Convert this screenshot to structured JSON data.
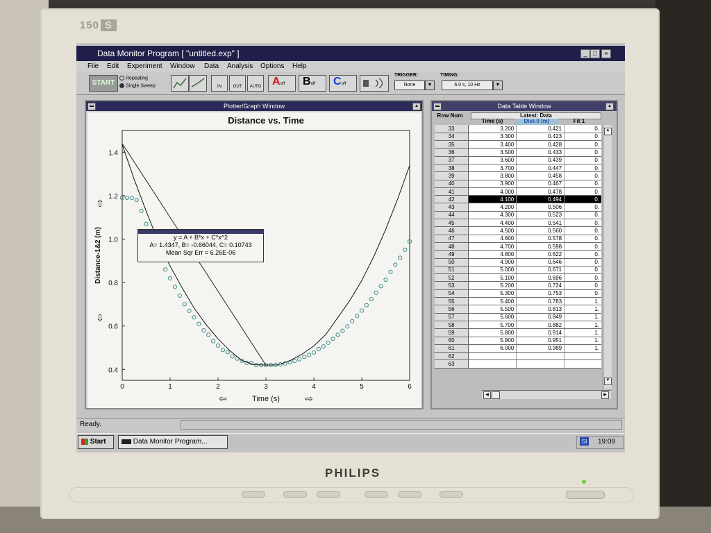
{
  "monitor": {
    "model": "150",
    "model_suffix": "S",
    "brand": "PHILIPS"
  },
  "app": {
    "title": "Data Monitor Program [ \"untitled.exp\" ]",
    "menu": [
      "File",
      "Edit",
      "Experiment",
      "Window",
      "Data",
      "Analysis",
      "Options",
      "Help"
    ],
    "toolbar": {
      "start_label": "START",
      "repeating_label": "Repeating",
      "single_sweep_label": "Single Sweep",
      "mode_selected": "Single Sweep",
      "zoom_in": "IN",
      "zoom_out": "OUT",
      "auto": "AUTO",
      "channel_a": "A",
      "channel_b": "B",
      "channel_c": "C",
      "channel_suffix": "off",
      "trigger_label": "TRIGGER:",
      "trigger_value": "None",
      "timing_label": "TIMING:",
      "timing_value": "6.0 s, 10 Hz"
    }
  },
  "plotter": {
    "window_title": "Plotter/Graph Window",
    "fit_box": {
      "equation": "y = A + B*x + C*x^2",
      "coefficients": "A= 1.4347,  B= -0.66044,  C= 0.10743",
      "error": "Mean Sqr Err = 6.26E-06"
    }
  },
  "chart_data": {
    "type": "scatter",
    "title": "Distance vs. Time",
    "xlabel": "Time (s)",
    "ylabel": "Distance-1&2 (m)",
    "xlim": [
      0,
      6
    ],
    "ylim": [
      0.35,
      1.5
    ],
    "xticks": [
      "0",
      "1",
      "2",
      "3",
      "4",
      "5",
      "6"
    ],
    "yticks": [
      "0.4",
      "0.6",
      "0.8",
      "1.0",
      "1.2",
      "1.4"
    ],
    "series": [
      {
        "name": "",
        "kind": "points",
        "color": "#3d8a8a",
        "x": [
          0.0,
          0.1,
          0.2,
          0.3,
          0.4,
          0.5,
          0.6,
          0.7,
          0.8,
          0.9,
          1.0,
          1.1,
          1.2,
          1.3,
          1.4,
          1.5,
          1.6,
          1.7,
          1.8,
          1.9,
          2.0,
          2.1,
          2.2,
          2.3,
          2.4,
          2.5,
          2.6,
          2.7,
          2.8,
          2.9,
          3.0,
          3.1,
          3.2,
          3.3,
          3.4,
          3.5,
          3.6,
          3.7,
          3.8,
          3.9,
          4.0,
          4.1,
          4.2,
          4.3,
          4.4,
          4.5,
          4.6,
          4.7,
          4.8,
          4.9,
          5.0,
          5.1,
          5.2,
          5.3,
          5.4,
          5.5,
          5.6,
          5.7,
          5.8,
          5.9,
          6.0
        ],
        "y": [
          1.19,
          1.19,
          1.19,
          1.18,
          1.13,
          1.07,
          1.01,
          0.96,
          0.91,
          0.86,
          0.82,
          0.78,
          0.74,
          0.7,
          0.67,
          0.64,
          0.61,
          0.58,
          0.56,
          0.53,
          0.51,
          0.49,
          0.48,
          0.46,
          0.45,
          0.44,
          0.43,
          0.43,
          0.42,
          0.42,
          0.42,
          0.42,
          0.421,
          0.423,
          0.428,
          0.433,
          0.439,
          0.447,
          0.458,
          0.467,
          0.478,
          0.494,
          0.506,
          0.523,
          0.541,
          0.56,
          0.578,
          0.598,
          0.622,
          0.646,
          0.671,
          0.696,
          0.724,
          0.753,
          0.783,
          0.813,
          0.849,
          0.882,
          0.914,
          0.951,
          0.989
        ]
      },
      {
        "name": "",
        "kind": "fit",
        "color": "#111111",
        "x": [
          0.0,
          0.25,
          0.5,
          0.75,
          1.0,
          1.25,
          1.5,
          1.75,
          2.0,
          2.25,
          2.5,
          2.75,
          3.0,
          3.25,
          3.5,
          3.75,
          4.0,
          4.25,
          4.5,
          4.75,
          5.0,
          5.25,
          5.5,
          5.75,
          6.0
        ],
        "y": [
          1.435,
          1.275,
          1.129,
          0.99,
          0.876,
          0.776,
          0.683,
          0.607,
          0.541,
          0.486,
          0.441,
          0.422,
          0.42,
          0.421,
          0.44,
          0.47,
          0.508,
          0.561,
          0.639,
          0.717,
          0.809,
          0.919,
          1.045,
          1.185,
          1.339
        ]
      },
      {
        "name": "",
        "kind": "line",
        "color": "#222222",
        "x": [
          0.0,
          3.0
        ],
        "y": [
          1.44,
          0.42
        ]
      }
    ]
  },
  "table": {
    "window_title": "Data Table Window",
    "row_num_label": "Row Num",
    "latest_label": "Latest: Data",
    "columns": [
      "Time (s)",
      "Dist-0 (m)",
      "Fit 1"
    ],
    "selected_row": "42",
    "rows": [
      [
        "33",
        "3.200",
        "0.421",
        "0."
      ],
      [
        "34",
        "3.300",
        "0.423",
        "0."
      ],
      [
        "35",
        "3.400",
        "0.428",
        "0."
      ],
      [
        "36",
        "3.500",
        "0.433",
        "0."
      ],
      [
        "37",
        "3.600",
        "0.439",
        "0."
      ],
      [
        "38",
        "3.700",
        "0.447",
        "0."
      ],
      [
        "39",
        "3.800",
        "0.458",
        "0."
      ],
      [
        "40",
        "3.900",
        "0.467",
        "0."
      ],
      [
        "41",
        "4.000",
        "0.478",
        "0."
      ],
      [
        "42",
        "4.100",
        "0.494",
        "0."
      ],
      [
        "43",
        "4.200",
        "0.506",
        "0."
      ],
      [
        "44",
        "4.300",
        "0.523",
        "0."
      ],
      [
        "45",
        "4.400",
        "0.541",
        "0."
      ],
      [
        "46",
        "4.500",
        "0.560",
        "0."
      ],
      [
        "47",
        "4.600",
        "0.578",
        "0."
      ],
      [
        "48",
        "4.700",
        "0.598",
        "0."
      ],
      [
        "49",
        "4.800",
        "0.622",
        "0."
      ],
      [
        "50",
        "4.900",
        "0.646",
        "0."
      ],
      [
        "51",
        "5.000",
        "0.671",
        "0."
      ],
      [
        "52",
        "5.100",
        "0.696",
        "0."
      ],
      [
        "53",
        "5.200",
        "0.724",
        "0."
      ],
      [
        "54",
        "5.300",
        "0.753",
        "0."
      ],
      [
        "55",
        "5.400",
        "0.783",
        "1."
      ],
      [
        "56",
        "5.500",
        "0.813",
        "1."
      ],
      [
        "57",
        "5.600",
        "0.849",
        "1."
      ],
      [
        "58",
        "5.700",
        "0.882",
        "1."
      ],
      [
        "59",
        "5.800",
        "0.914",
        "1."
      ],
      [
        "60",
        "5.900",
        "0.951",
        "1."
      ],
      [
        "61",
        "6.000",
        "0.989",
        "1."
      ],
      [
        "62",
        "",
        "",
        ""
      ],
      [
        "63",
        "",
        "",
        ""
      ]
    ]
  },
  "status": {
    "text": "Ready."
  },
  "taskbar": {
    "start": "Start",
    "task": "Data Monitor Program...",
    "tray_icon": "SI",
    "clock": "19:09"
  }
}
